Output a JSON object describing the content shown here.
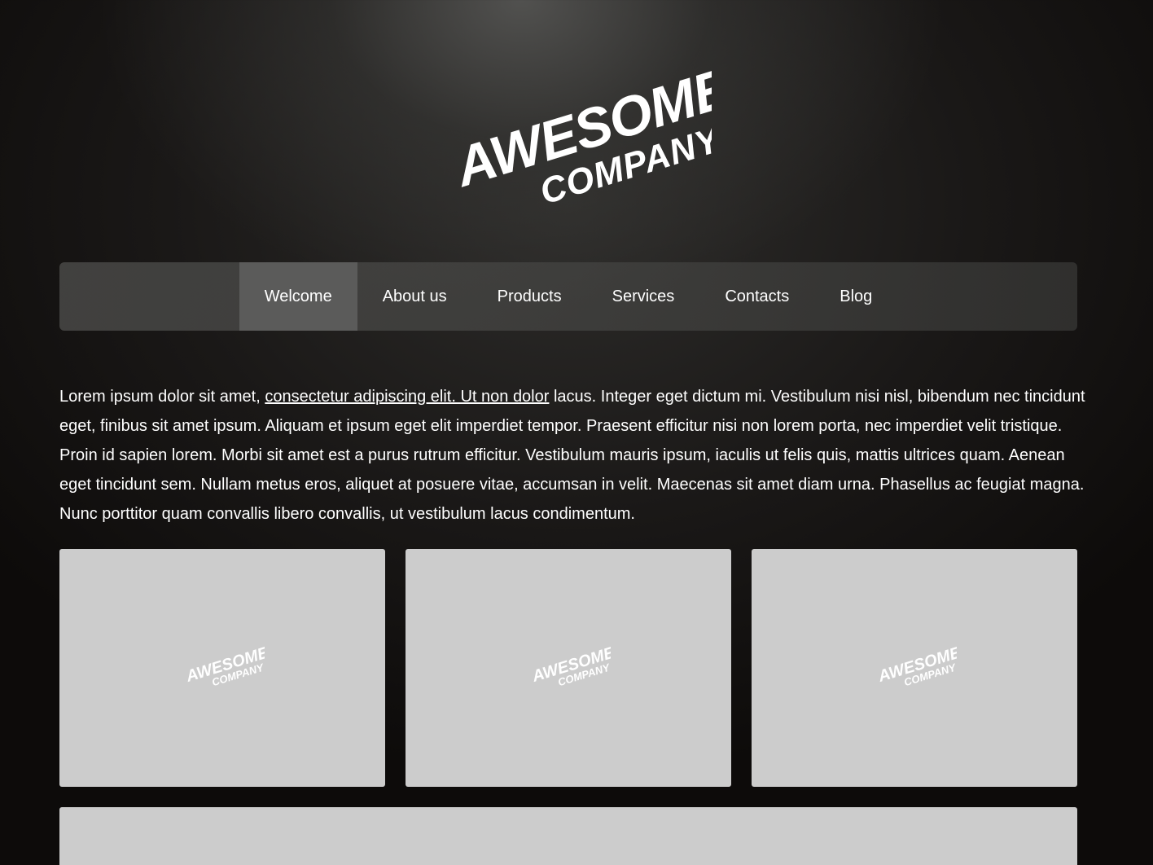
{
  "logo": {
    "line1": "AWESOME",
    "line2": "COMPANY",
    "icon": "awesome-company-logo"
  },
  "nav": {
    "items": [
      {
        "label": "Welcome",
        "active": true
      },
      {
        "label": "About us",
        "active": false
      },
      {
        "label": "Products",
        "active": false
      },
      {
        "label": "Services",
        "active": false
      },
      {
        "label": "Contacts",
        "active": false
      },
      {
        "label": "Blog",
        "active": false
      }
    ]
  },
  "intro": {
    "before_link": "Lorem ipsum dolor sit amet, ",
    "link_text": "consectetur adipiscing elit. Ut non dolor",
    "after_link": " lacus. Integer eget dictum mi. Vestibulum nisi nisl, bibendum nec tincidunt eget, finibus sit amet ipsum. Aliquam et ipsum eget elit imperdiet tempor. Praesent efficitur nisi non lorem porta, nec imperdiet velit tristique. Proin id sapien lorem. Morbi sit amet est a purus rutrum efficitur. Vestibulum mauris ipsum, iaculis ut felis quis, mattis ultrices quam. Aenean eget tincidunt sem. Nullam metus eros, aliquet at posuere vitae, accumsan in velit. Maecenas sit amet diam urna. Phasellus ac feugiat magna. Nunc porttitor quam convallis libero convallis, ut vestibulum lacus condimentum."
  },
  "cards": [
    {
      "logo_line1": "AWESOME",
      "logo_line2": "COMPANY"
    },
    {
      "logo_line1": "AWESOME",
      "logo_line2": "COMPANY"
    },
    {
      "logo_line1": "AWESOME",
      "logo_line2": "COMPANY"
    }
  ],
  "colors": {
    "nav_active": "#5b5b5a",
    "card_bg": "#cccccc",
    "text": "#ffffff"
  }
}
